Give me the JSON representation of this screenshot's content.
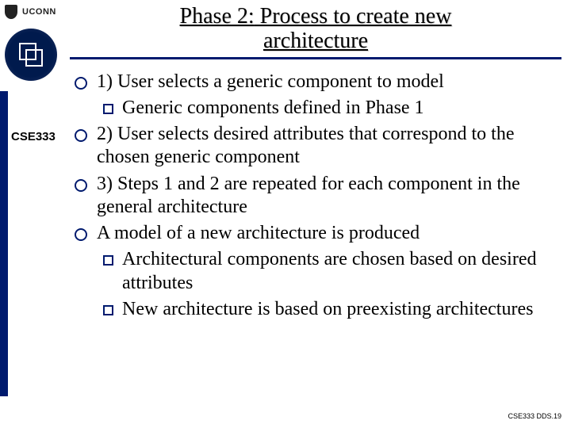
{
  "header": {
    "uconn_text": "UCONN"
  },
  "sidebar": {
    "course": "CSE333"
  },
  "title": {
    "prefix": "Phase 2:",
    "rest_line1": " Process to create new",
    "line2": "architecture"
  },
  "bullets": [
    {
      "level": 1,
      "text": "1) User selects a generic component to model"
    },
    {
      "level": 2,
      "text": "Generic components defined in Phase 1"
    },
    {
      "level": 1,
      "text": "2) User selects desired attributes that correspond to the chosen generic component"
    },
    {
      "level": 1,
      "text": "3) Steps 1 and 2 are repeated for each component in the general architecture"
    },
    {
      "level": 1,
      "text": "A model of a new architecture is produced"
    },
    {
      "level": 2,
      "text": "Architectural components are chosen based on desired attributes"
    },
    {
      "level": 2,
      "text": "New architecture is based on preexisting architectures"
    }
  ],
  "footer": {
    "text": "CSE333 DDS.19"
  }
}
